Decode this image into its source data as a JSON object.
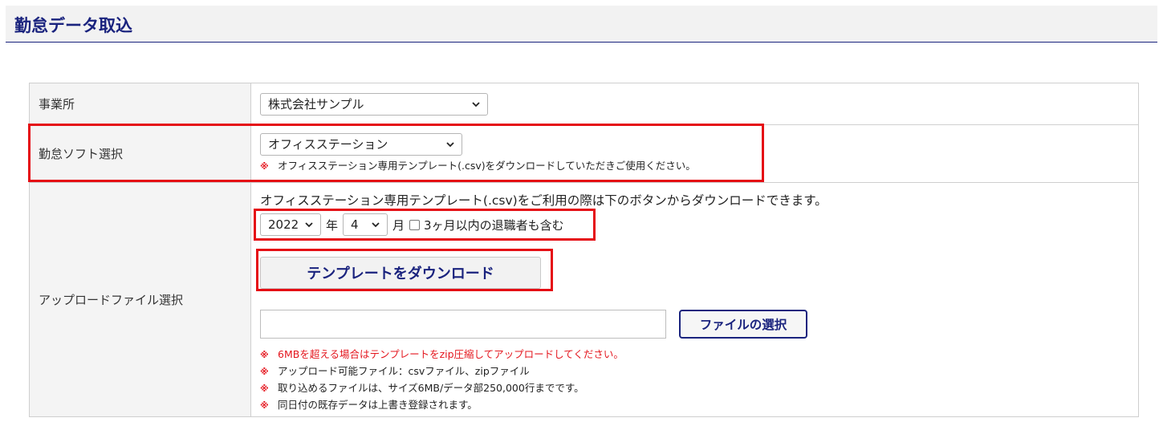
{
  "page": {
    "title": "勤怠データ取込"
  },
  "office": {
    "label": "事業所",
    "selected": "株式会社サンプル"
  },
  "software": {
    "label": "勤怠ソフト選択",
    "selected": "オフィスステーション",
    "note_mark": "※",
    "note": "オフィスステーション専用テンプレート(.csv)をダウンロードしていただきご使用ください。"
  },
  "upload": {
    "label": "アップロードファイル選択",
    "description": "オフィスステーション専用テンプレート(.csv)をご利用の際は下のボタンからダウンロードできます。",
    "year_value": "2022",
    "year_unit": "年",
    "month_value": "4",
    "month_unit": "月",
    "retiree_checkbox_label": "3ヶ月以内の退職者も含む",
    "retiree_checked": false,
    "download_button": "テンプレートをダウンロード",
    "file_select_button": "ファイルの選択",
    "note_mark": "※",
    "notes": [
      "6MBを超える場合はテンプレートをzip圧縮してアップロードしてください。",
      "アップロード可能ファイル：csvファイル、zipファイル",
      "取り込めるファイルは、サイズ6MB/データ部250,000行までです。",
      "同日付の既存データは上書き登録されます。"
    ]
  },
  "colors": {
    "title": "#1a237e",
    "highlight": "#e50d14",
    "warning_text": "#e4161e",
    "label_bg": "#f4f4f4"
  }
}
